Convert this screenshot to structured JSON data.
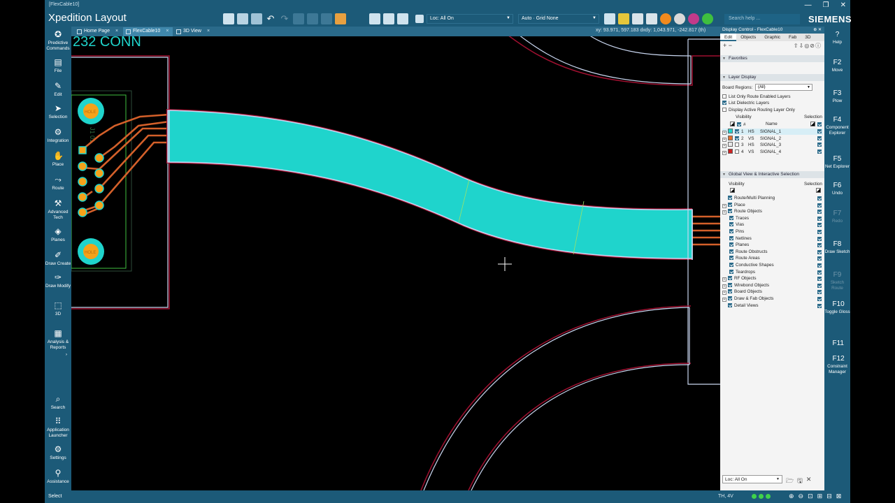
{
  "window": {
    "doc_title": "[FlexCable10]",
    "app_title": "Xpedition Layout",
    "brand": "SIEMENS",
    "search_placeholder": "Search help ..."
  },
  "toolbar": {
    "layer_combo": "Loc: All On",
    "grid_combo": "Auto · Grid None"
  },
  "tabs": [
    {
      "label": "Home Page"
    },
    {
      "label": "FlexCable10"
    },
    {
      "label": "3D View"
    }
  ],
  "coordinates": "xy: 93.971, 597.183  dxdy: 1,043.971, -242.817  (th)",
  "left_nav": [
    {
      "label": "Predictive Commands",
      "icon": "predictive-icon"
    },
    {
      "label": "File",
      "icon": "file-icon"
    },
    {
      "label": "Edit",
      "icon": "edit-icon"
    },
    {
      "label": "Selection",
      "icon": "cursor-icon"
    },
    {
      "label": "Integration",
      "icon": "integration-icon"
    },
    {
      "label": "Place",
      "icon": "place-icon"
    },
    {
      "label": "Route",
      "icon": "route-icon"
    },
    {
      "label": "Advanced Tech",
      "icon": "advanced-icon"
    },
    {
      "label": "Planes",
      "icon": "planes-icon"
    },
    {
      "label": "Draw Create",
      "icon": "pen-icon"
    },
    {
      "label": "Draw Modify",
      "icon": "draw-modify-icon"
    },
    {
      "label": "3D",
      "icon": "cube-icon"
    },
    {
      "label": "Analysis & Reports",
      "icon": "analysis-icon"
    },
    {
      "label": "Search",
      "icon": "search-icon"
    },
    {
      "label": "Application Launcher",
      "icon": "grid-icon"
    },
    {
      "label": "Settings",
      "icon": "gear-icon"
    },
    {
      "label": "Assistance",
      "icon": "person-icon"
    }
  ],
  "canvas": {
    "connector_label": "232 CONN",
    "pin_label_top": "HOLE",
    "pin_label_bottom": "HOLE",
    "ref_text": "J1  01"
  },
  "panel": {
    "title": "Display Control - FlexCable10",
    "tabs": [
      "Edit",
      "Objects",
      "Graphic",
      "Fab",
      "3D"
    ],
    "favorites": "Favorites",
    "layer_display": "Layer Display",
    "board_regions_label": "Board Regions:",
    "board_regions_value": "(All)",
    "opt_route_enabled": "List Only Route Enabled Layers",
    "opt_dielectric": "List Dielectric Layers",
    "opt_active": "Display Active Routing Layer Only",
    "col_visibility": "Visibility",
    "col_selection": "Selection",
    "col_num": "#",
    "col_name": "Name",
    "layers": [
      {
        "num": "1",
        "type": "HS",
        "name": "SIGNAL_1",
        "color": "#1fd4cc"
      },
      {
        "num": "2",
        "type": "VS",
        "name": "SIGNAL_2",
        "color": "#e07030"
      },
      {
        "num": "3",
        "type": "HS",
        "name": "SIGNAL_3",
        "color": "#e8e8e8"
      },
      {
        "num": "4",
        "type": "VS",
        "name": "SIGNAL_4",
        "color": "#cc2222"
      }
    ],
    "global_view": "Global View & Interactive Selection",
    "gv_visibility": "Visibility",
    "gv_selection": "Selection",
    "objects": [
      {
        "label": "Route/Multi Planning",
        "level": 0,
        "expand": false
      },
      {
        "label": "Place",
        "level": 0,
        "expand": true
      },
      {
        "label": "Route Objects",
        "level": 0,
        "expand": true
      },
      {
        "label": "Traces",
        "level": 1,
        "expand": false
      },
      {
        "label": "Vias",
        "level": 1,
        "expand": false
      },
      {
        "label": "Pins",
        "level": 1,
        "expand": false
      },
      {
        "label": "Netlines",
        "level": 1,
        "expand": false
      },
      {
        "label": "Planes",
        "level": 1,
        "expand": false
      },
      {
        "label": "Route Obstructs",
        "level": 1,
        "expand": false
      },
      {
        "label": "Route Areas",
        "level": 1,
        "expand": false
      },
      {
        "label": "Conductive Shapes",
        "level": 1,
        "expand": false
      },
      {
        "label": "Teardrops",
        "level": 1,
        "expand": false
      },
      {
        "label": "RF Objects",
        "level": 0,
        "expand": true
      },
      {
        "label": "Wirebond Objects",
        "level": 0,
        "expand": true
      },
      {
        "label": "Board Objects",
        "level": 0,
        "expand": true
      },
      {
        "label": "Draw & Fab Objects",
        "level": 0,
        "expand": true
      },
      {
        "label": "Detail Views",
        "level": 0,
        "expand": false
      }
    ],
    "loc_combo": "Loc: All On"
  },
  "right_bar": [
    {
      "key": "?",
      "label": "Help",
      "dim": false
    },
    {
      "key": "F2",
      "label": "Move",
      "dim": false
    },
    {
      "key": "F3",
      "label": "Plow",
      "dim": false
    },
    {
      "key": "F4",
      "label": "Component Explorer",
      "dim": false
    },
    {
      "key": "F5",
      "label": "Net Explorer",
      "dim": false
    },
    {
      "key": "F6",
      "label": "Undo",
      "dim": false
    },
    {
      "key": "F7",
      "label": "Redo",
      "dim": true
    },
    {
      "key": "F8",
      "label": "Draw Sketch",
      "dim": false
    },
    {
      "key": "F9",
      "label": "Sketch Route",
      "dim": true
    },
    {
      "key": "F10",
      "label": "Toggle Gloss",
      "dim": false
    },
    {
      "key": "F11",
      "label": "",
      "dim": false
    },
    {
      "key": "F12",
      "label": "Constraint Manager",
      "dim": false
    }
  ],
  "status": {
    "mode": "Select",
    "layer": "TH, 4V"
  },
  "colors": {
    "flex": "#1fd4cc",
    "trace": "#d4602a",
    "outline": "#c9d6f0",
    "keepout": "#a01030",
    "pad": "#f5a21a",
    "silk": "#3fbf3f",
    "chrome": "#1c5a78"
  }
}
